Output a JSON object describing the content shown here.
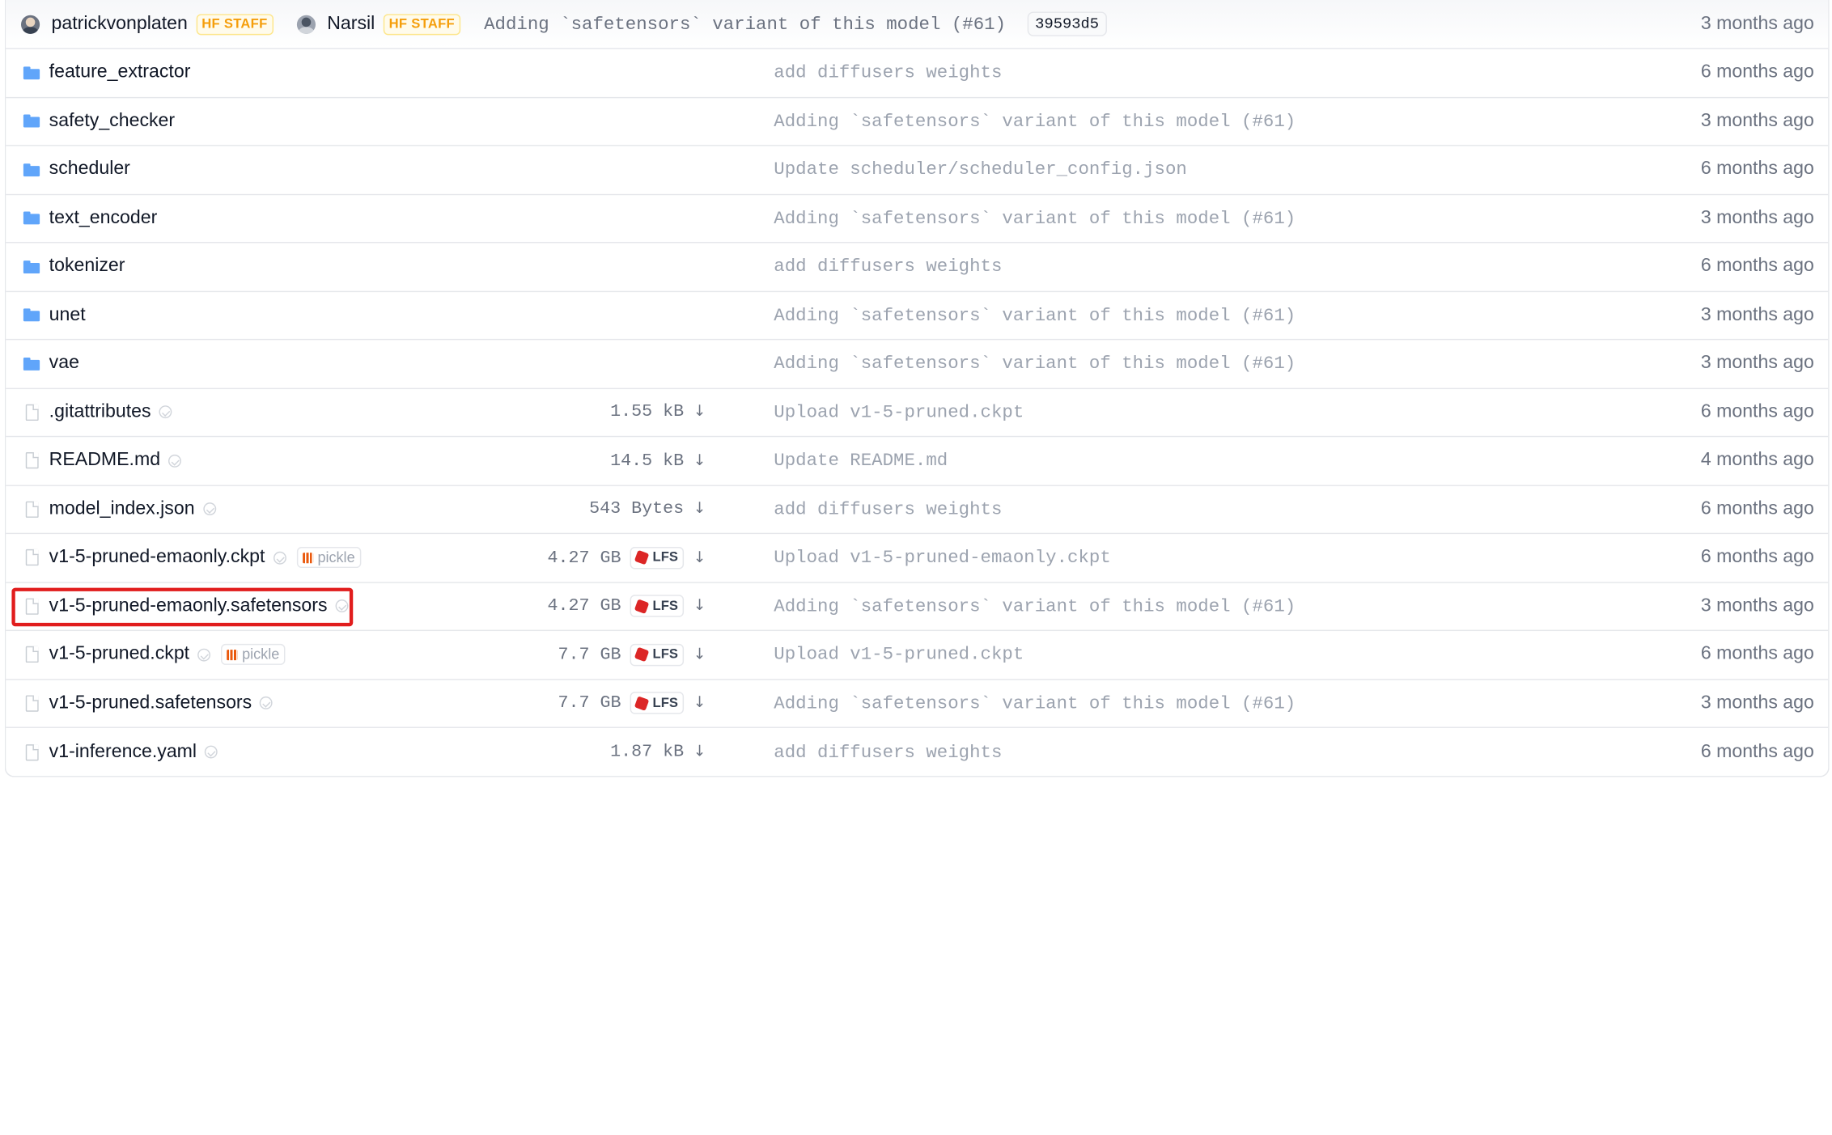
{
  "commit": {
    "author1": "patrickvonplaten",
    "author1_badge": "HF STAFF",
    "author2": "Narsil",
    "author2_badge": "HF STAFF",
    "message": "Adding `safetensors` variant of this model (#61)",
    "hash": "39593d5",
    "date": "3 months ago"
  },
  "rows": [
    {
      "type": "folder",
      "name": "feature_extractor",
      "message": "add diffusers weights",
      "date": "6 months ago"
    },
    {
      "type": "folder",
      "name": "safety_checker",
      "message": "Adding `safetensors` variant of this model (#61)",
      "date": "3 months ago"
    },
    {
      "type": "folder",
      "name": "scheduler",
      "message": "Update scheduler/scheduler_config.json",
      "date": "6 months ago"
    },
    {
      "type": "folder",
      "name": "text_encoder",
      "message": "Adding `safetensors` variant of this model (#61)",
      "date": "3 months ago"
    },
    {
      "type": "folder",
      "name": "tokenizer",
      "message": "add diffusers weights",
      "date": "6 months ago"
    },
    {
      "type": "folder",
      "name": "unet",
      "message": "Adding `safetensors` variant of this model (#61)",
      "date": "3 months ago"
    },
    {
      "type": "folder",
      "name": "vae",
      "message": "Adding `safetensors` variant of this model (#61)",
      "date": "3 months ago"
    },
    {
      "type": "file",
      "name": ".gitattributes",
      "size": "1.55 kB",
      "lfs": false,
      "pickle": false,
      "message": "Upload v1-5-pruned.ckpt",
      "date": "6 months ago"
    },
    {
      "type": "file",
      "name": "README.md",
      "size": "14.5 kB",
      "lfs": false,
      "pickle": false,
      "message": "Update README.md",
      "date": "4 months ago"
    },
    {
      "type": "file",
      "name": "model_index.json",
      "size": "543 Bytes",
      "lfs": false,
      "pickle": false,
      "message": "add diffusers weights",
      "date": "6 months ago"
    },
    {
      "type": "file",
      "name": "v1-5-pruned-emaonly.ckpt",
      "size": "4.27 GB",
      "lfs": true,
      "pickle": true,
      "message": "Upload v1-5-pruned-emaonly.ckpt",
      "date": "6 months ago"
    },
    {
      "type": "file",
      "name": "v1-5-pruned-emaonly.safetensors",
      "size": "4.27 GB",
      "lfs": true,
      "pickle": false,
      "message": "Adding `safetensors` variant of this model (#61)",
      "date": "3 months ago",
      "highlighted": true
    },
    {
      "type": "file",
      "name": "v1-5-pruned.ckpt",
      "size": "7.7 GB",
      "lfs": true,
      "pickle": true,
      "message": "Upload v1-5-pruned.ckpt",
      "date": "6 months ago"
    },
    {
      "type": "file",
      "name": "v1-5-pruned.safetensors",
      "size": "7.7 GB",
      "lfs": true,
      "pickle": false,
      "message": "Adding `safetensors` variant of this model (#61)",
      "date": "3 months ago"
    },
    {
      "type": "file",
      "name": "v1-inference.yaml",
      "size": "1.87 kB",
      "lfs": false,
      "pickle": false,
      "message": "add diffusers weights",
      "date": "6 months ago"
    }
  ],
  "labels": {
    "lfs": "LFS",
    "pickle": "pickle",
    "download_glyph": "↓"
  },
  "colors": {
    "folder": "#60a5fa",
    "staff_badge": "#f59e0b",
    "highlight": "#e11d1d",
    "lfs": "#dc2626",
    "pickle": "#ea580c"
  }
}
